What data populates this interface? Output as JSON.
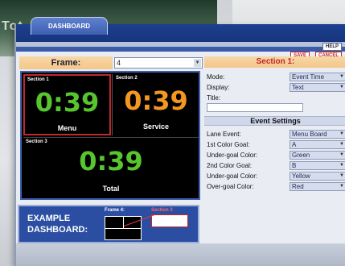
{
  "background": {
    "monitor_text": "Tot"
  },
  "app": {
    "tab_label": "DASHBOARD",
    "help_label": "HELP",
    "save_label": "SAVE",
    "cancel_label": "CANCEL"
  },
  "frame": {
    "label": "Frame:",
    "selected": "4"
  },
  "dashboard": {
    "sections": [
      {
        "label": "Section 1",
        "time": "0:39",
        "name": "Menu",
        "color": "#57c52e"
      },
      {
        "label": "Section 2",
        "time": "0:39",
        "name": "Service",
        "color": "#f49721"
      },
      {
        "label": "Section 3",
        "time": "0:39",
        "name": "Total",
        "color": "#57c52e"
      }
    ]
  },
  "example": {
    "line1": "EXAMPLE",
    "line2": "DASHBOARD:",
    "frame_label": "Frame 4:",
    "section_label": "Section 3"
  },
  "settings": {
    "section_title": "Section 1:",
    "mode": {
      "label": "Mode:",
      "value": "Event Time"
    },
    "display": {
      "label": "Display:",
      "value": "Text"
    },
    "title": {
      "label": "Title:",
      "value": ""
    },
    "event_header": "Event Settings",
    "lane_event": {
      "label": "Lane Event:",
      "value": "Menu Board"
    },
    "first_goal": {
      "label": "1st Color Goal:",
      "value": "A"
    },
    "under_goal_1": {
      "label": "Under-goal Color:",
      "value": "Green"
    },
    "second_goal": {
      "label": "2nd Color Goal:",
      "value": "B"
    },
    "under_goal_2": {
      "label": "Under-goal Color:",
      "value": "Yellow"
    },
    "over_goal": {
      "label": "Over-goal Color:",
      "value": "Red"
    }
  }
}
